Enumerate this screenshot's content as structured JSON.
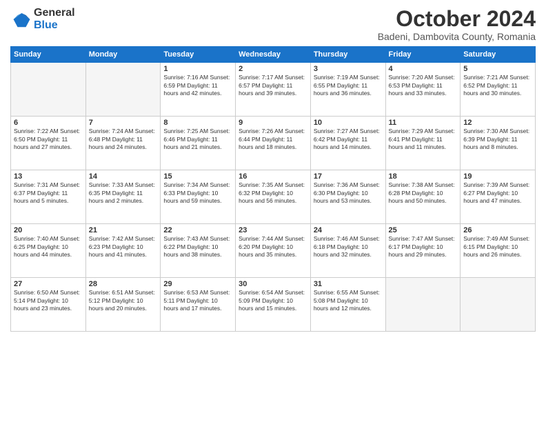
{
  "header": {
    "logo_line1": "General",
    "logo_line2": "Blue",
    "title": "October 2024",
    "subtitle": "Badeni, Dambovita County, Romania"
  },
  "days_of_week": [
    "Sunday",
    "Monday",
    "Tuesday",
    "Wednesday",
    "Thursday",
    "Friday",
    "Saturday"
  ],
  "weeks": [
    {
      "shade": false,
      "days": [
        {
          "num": "",
          "data": "",
          "empty": true
        },
        {
          "num": "",
          "data": "",
          "empty": true
        },
        {
          "num": "1",
          "data": "Sunrise: 7:16 AM\nSunset: 6:59 PM\nDaylight: 11 hours and 42 minutes."
        },
        {
          "num": "2",
          "data": "Sunrise: 7:17 AM\nSunset: 6:57 PM\nDaylight: 11 hours and 39 minutes."
        },
        {
          "num": "3",
          "data": "Sunrise: 7:19 AM\nSunset: 6:55 PM\nDaylight: 11 hours and 36 minutes."
        },
        {
          "num": "4",
          "data": "Sunrise: 7:20 AM\nSunset: 6:53 PM\nDaylight: 11 hours and 33 minutes."
        },
        {
          "num": "5",
          "data": "Sunrise: 7:21 AM\nSunset: 6:52 PM\nDaylight: 11 hours and 30 minutes."
        }
      ]
    },
    {
      "shade": true,
      "days": [
        {
          "num": "6",
          "data": "Sunrise: 7:22 AM\nSunset: 6:50 PM\nDaylight: 11 hours and 27 minutes."
        },
        {
          "num": "7",
          "data": "Sunrise: 7:24 AM\nSunset: 6:48 PM\nDaylight: 11 hours and 24 minutes."
        },
        {
          "num": "8",
          "data": "Sunrise: 7:25 AM\nSunset: 6:46 PM\nDaylight: 11 hours and 21 minutes."
        },
        {
          "num": "9",
          "data": "Sunrise: 7:26 AM\nSunset: 6:44 PM\nDaylight: 11 hours and 18 minutes."
        },
        {
          "num": "10",
          "data": "Sunrise: 7:27 AM\nSunset: 6:42 PM\nDaylight: 11 hours and 14 minutes."
        },
        {
          "num": "11",
          "data": "Sunrise: 7:29 AM\nSunset: 6:41 PM\nDaylight: 11 hours and 11 minutes."
        },
        {
          "num": "12",
          "data": "Sunrise: 7:30 AM\nSunset: 6:39 PM\nDaylight: 11 hours and 8 minutes."
        }
      ]
    },
    {
      "shade": false,
      "days": [
        {
          "num": "13",
          "data": "Sunrise: 7:31 AM\nSunset: 6:37 PM\nDaylight: 11 hours and 5 minutes."
        },
        {
          "num": "14",
          "data": "Sunrise: 7:33 AM\nSunset: 6:35 PM\nDaylight: 11 hours and 2 minutes."
        },
        {
          "num": "15",
          "data": "Sunrise: 7:34 AM\nSunset: 6:33 PM\nDaylight: 10 hours and 59 minutes."
        },
        {
          "num": "16",
          "data": "Sunrise: 7:35 AM\nSunset: 6:32 PM\nDaylight: 10 hours and 56 minutes."
        },
        {
          "num": "17",
          "data": "Sunrise: 7:36 AM\nSunset: 6:30 PM\nDaylight: 10 hours and 53 minutes."
        },
        {
          "num": "18",
          "data": "Sunrise: 7:38 AM\nSunset: 6:28 PM\nDaylight: 10 hours and 50 minutes."
        },
        {
          "num": "19",
          "data": "Sunrise: 7:39 AM\nSunset: 6:27 PM\nDaylight: 10 hours and 47 minutes."
        }
      ]
    },
    {
      "shade": true,
      "days": [
        {
          "num": "20",
          "data": "Sunrise: 7:40 AM\nSunset: 6:25 PM\nDaylight: 10 hours and 44 minutes."
        },
        {
          "num": "21",
          "data": "Sunrise: 7:42 AM\nSunset: 6:23 PM\nDaylight: 10 hours and 41 minutes."
        },
        {
          "num": "22",
          "data": "Sunrise: 7:43 AM\nSunset: 6:22 PM\nDaylight: 10 hours and 38 minutes."
        },
        {
          "num": "23",
          "data": "Sunrise: 7:44 AM\nSunset: 6:20 PM\nDaylight: 10 hours and 35 minutes."
        },
        {
          "num": "24",
          "data": "Sunrise: 7:46 AM\nSunset: 6:18 PM\nDaylight: 10 hours and 32 minutes."
        },
        {
          "num": "25",
          "data": "Sunrise: 7:47 AM\nSunset: 6:17 PM\nDaylight: 10 hours and 29 minutes."
        },
        {
          "num": "26",
          "data": "Sunrise: 7:49 AM\nSunset: 6:15 PM\nDaylight: 10 hours and 26 minutes."
        }
      ]
    },
    {
      "shade": false,
      "days": [
        {
          "num": "27",
          "data": "Sunrise: 6:50 AM\nSunset: 5:14 PM\nDaylight: 10 hours and 23 minutes."
        },
        {
          "num": "28",
          "data": "Sunrise: 6:51 AM\nSunset: 5:12 PM\nDaylight: 10 hours and 20 minutes."
        },
        {
          "num": "29",
          "data": "Sunrise: 6:53 AM\nSunset: 5:11 PM\nDaylight: 10 hours and 17 minutes."
        },
        {
          "num": "30",
          "data": "Sunrise: 6:54 AM\nSunset: 5:09 PM\nDaylight: 10 hours and 15 minutes."
        },
        {
          "num": "31",
          "data": "Sunrise: 6:55 AM\nSunset: 5:08 PM\nDaylight: 10 hours and 12 minutes."
        },
        {
          "num": "",
          "data": "",
          "empty": true
        },
        {
          "num": "",
          "data": "",
          "empty": true
        }
      ]
    }
  ]
}
